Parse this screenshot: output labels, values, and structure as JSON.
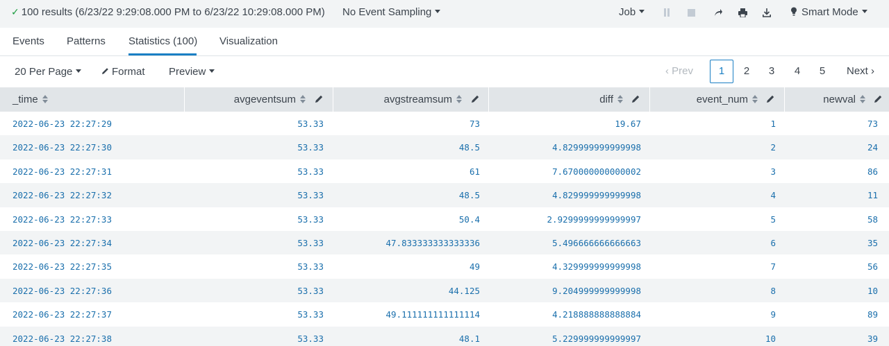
{
  "jobbar": {
    "status_text": "100 results (6/23/22 9:29:08.000 PM to 6/23/22 10:29:08.000 PM)",
    "sampling_label": "No Event Sampling",
    "job_label": "Job",
    "mode_label": "Smart Mode"
  },
  "tabs": [
    {
      "label": "Events"
    },
    {
      "label": "Patterns"
    },
    {
      "label": "Statistics (100)"
    },
    {
      "label": "Visualization"
    }
  ],
  "toolbar": {
    "per_page_label": "20 Per Page",
    "format_label": "Format",
    "preview_label": "Preview"
  },
  "pager": {
    "prev_label": "‹ Prev",
    "pages": [
      "1",
      "2",
      "3",
      "4",
      "5"
    ],
    "current_page": "1",
    "next_label": "Next ›"
  },
  "table": {
    "columns": [
      "_time",
      "avgeventsum",
      "avgstreamsum",
      "diff",
      "event_num",
      "newval"
    ],
    "rows": [
      [
        "2022-06-23 22:27:29",
        "53.33",
        "73",
        "19.67",
        "1",
        "73"
      ],
      [
        "2022-06-23 22:27:30",
        "53.33",
        "48.5",
        "4.829999999999998",
        "2",
        "24"
      ],
      [
        "2022-06-23 22:27:31",
        "53.33",
        "61",
        "7.670000000000002",
        "3",
        "86"
      ],
      [
        "2022-06-23 22:27:32",
        "53.33",
        "48.5",
        "4.829999999999998",
        "4",
        "11"
      ],
      [
        "2022-06-23 22:27:33",
        "53.33",
        "50.4",
        "2.9299999999999997",
        "5",
        "58"
      ],
      [
        "2022-06-23 22:27:34",
        "53.33",
        "47.833333333333336",
        "5.496666666666663",
        "6",
        "35"
      ],
      [
        "2022-06-23 22:27:35",
        "53.33",
        "49",
        "4.329999999999998",
        "7",
        "56"
      ],
      [
        "2022-06-23 22:27:36",
        "53.33",
        "44.125",
        "9.204999999999998",
        "8",
        "10"
      ],
      [
        "2022-06-23 22:27:37",
        "53.33",
        "49.111111111111114",
        "4.218888888888884",
        "9",
        "89"
      ],
      [
        "2022-06-23 22:27:38",
        "53.33",
        "48.1",
        "5.229999999999997",
        "10",
        "39"
      ]
    ]
  },
  "colors": {
    "accent": "#1a7fc4",
    "cell_text": "#1a6fac",
    "header_bg": "#e1e5e8",
    "stripe_bg": "#f2f4f5"
  }
}
